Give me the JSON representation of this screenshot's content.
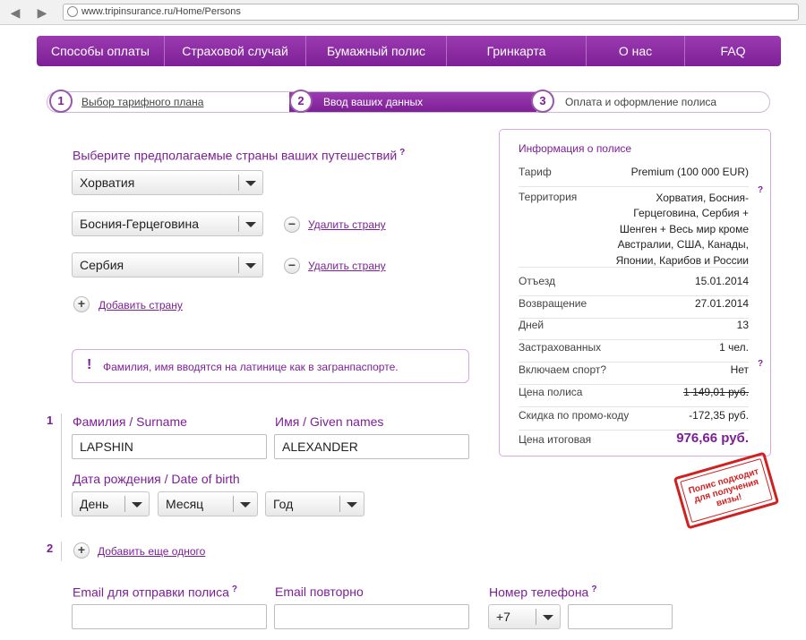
{
  "browser": {
    "url": "www.tripinsurance.ru/Home/Persons"
  },
  "nav": [
    "Способы оплаты",
    "Страховой случай",
    "Бумажный полис",
    "Гринкарта",
    "О нас",
    "FAQ"
  ],
  "steps": [
    {
      "num": "1",
      "label": "Выбор тарифного плана"
    },
    {
      "num": "2",
      "label": "Ввод ваших данных"
    },
    {
      "num": "3",
      "label": "Оплата и оформление полиса"
    }
  ],
  "countries": {
    "heading": "Выберите предполагаемые страны ваших путешествий",
    "qmark": "?",
    "selected": [
      "Хорватия",
      "Босния-Герцеговина",
      "Сербия"
    ],
    "remove_label": "Удалить страну",
    "add_label": "Добавить страну",
    "remove_sign": "−",
    "add_sign": "+"
  },
  "notice": {
    "mark": "!",
    "text": "Фамилия, имя вводятся на латинице как в загранпаспорте."
  },
  "person1": {
    "index": "1",
    "surname_label": "Фамилия / Surname",
    "surname_value": "LAPSHIN",
    "name_label": "Имя / Given names",
    "name_value": "ALEXANDER",
    "dob_label": "Дата рождения / Date of birth",
    "day": "День",
    "month": "Месяц",
    "year": "Год"
  },
  "person2": {
    "index": "2",
    "add_label": "Добавить еще одного"
  },
  "contact": {
    "email_label": "Email для отправки полиса",
    "email_repeat_label": "Email повторно",
    "phone_label": "Номер телефона",
    "phone_code": "+7"
  },
  "info": {
    "title": "Информация о полисе",
    "tariff_k": "Тариф",
    "tariff_v": "Premium (100 000 EUR)",
    "territory_k": "Территория",
    "territory_v": [
      "Хорватия, Босния-",
      "Герцеговина, Сербия +",
      "Шенген + Весь мир кроме",
      "Австралии, США, Канады,",
      "Японии, Карибов и России"
    ],
    "depart_k": "Отъезд",
    "depart_v": "15.01.2014",
    "return_k": "Возвращение",
    "return_v": "27.01.2014",
    "days_k": "Дней",
    "days_v": "13",
    "insured_k": "Застрахованных",
    "insured_v": "1 чел.",
    "sport_k": "Включаем спорт?",
    "sport_v": "Нет",
    "price_k": "Цена полиса",
    "price_v": "1 149,01 руб.",
    "discount_k": "Скидка по промо-коду",
    "discount_v": "-172,35 руб.",
    "total_k": "Цена итоговая",
    "total_v": "976,66 руб."
  },
  "stamp": [
    "Полис подходит",
    "для получения",
    "визы!"
  ],
  "colors": {
    "accent": "#7d1f96",
    "stamp": "#d02020"
  }
}
